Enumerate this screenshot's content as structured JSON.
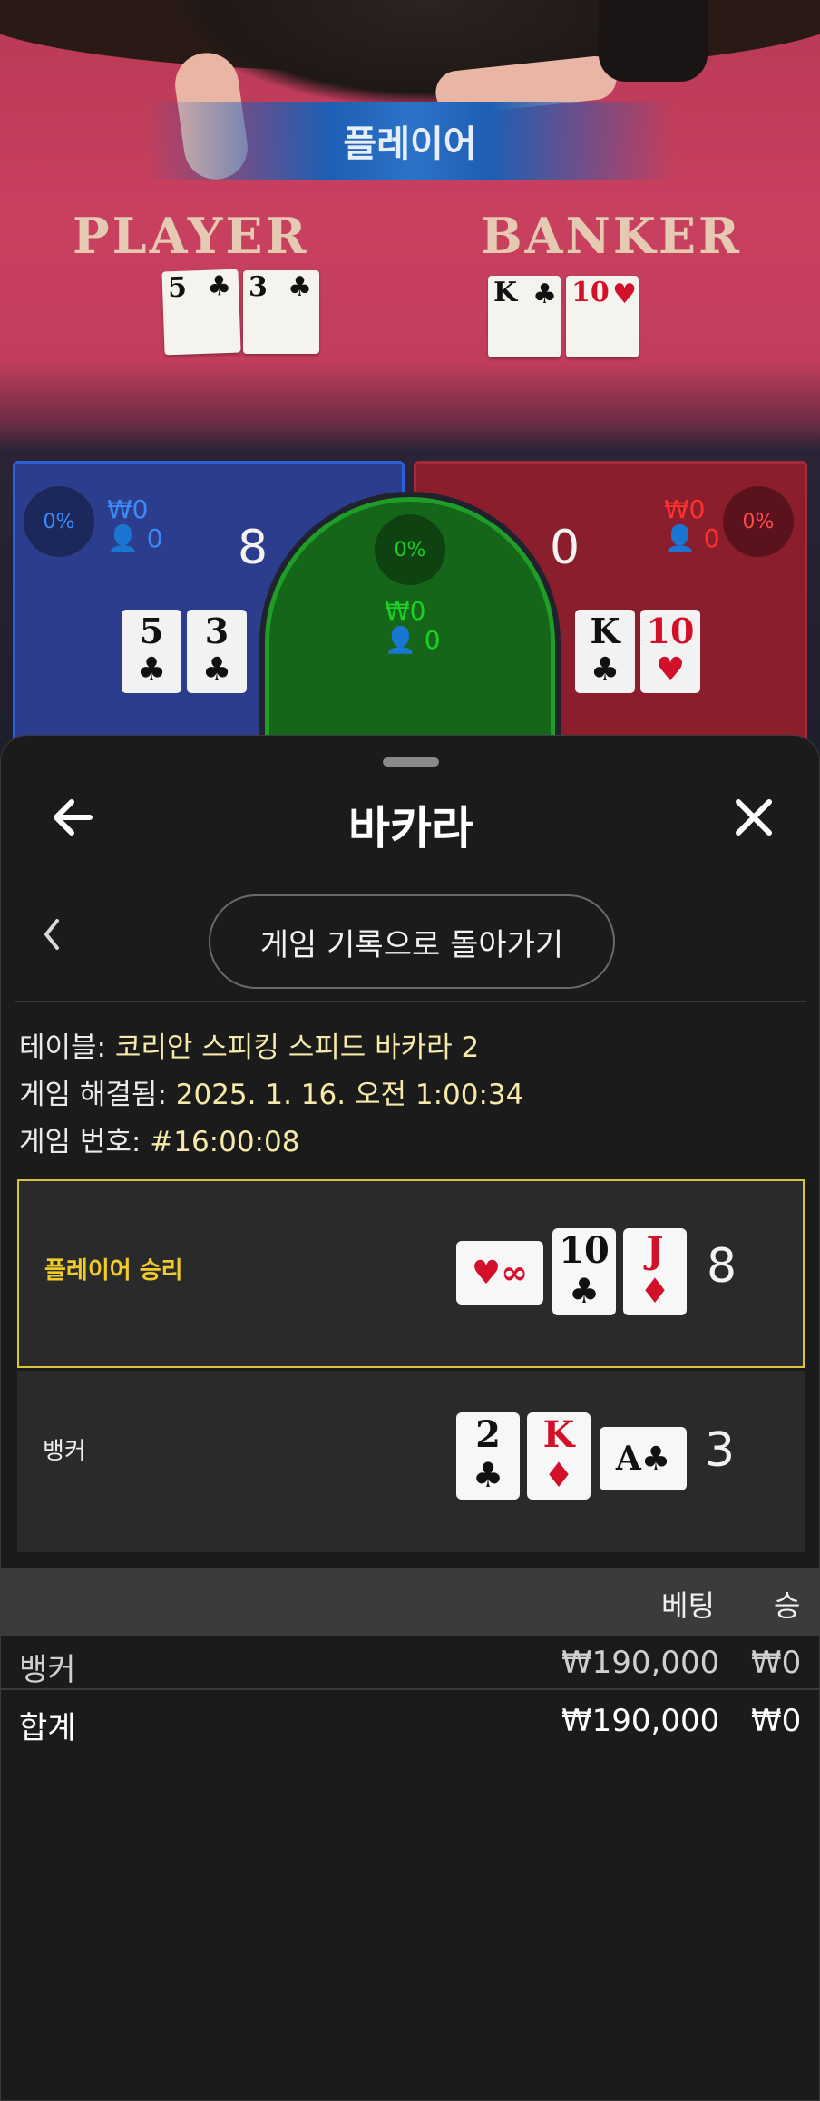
{
  "game": {
    "result_banner": "플레이어",
    "felt_player_label": "PLAYER",
    "felt_banker_label": "BANKER",
    "table_player_cards": [
      {
        "rank": "5",
        "suit": "♣",
        "color": "black"
      },
      {
        "rank": "3",
        "suit": "♣",
        "color": "black"
      }
    ],
    "table_banker_cards": [
      {
        "rank": "K",
        "suit": "♣",
        "color": "black"
      },
      {
        "rank": "10",
        "suit": "♥",
        "color": "red"
      }
    ],
    "player_zone": {
      "percent": "0%",
      "amount": "₩0",
      "count": "0",
      "score": "8",
      "cards": [
        {
          "rank": "5",
          "suit": "♣",
          "color": "black"
        },
        {
          "rank": "3",
          "suit": "♣",
          "color": "black"
        }
      ]
    },
    "tie_zone": {
      "percent": "0%",
      "amount": "₩0",
      "count": "0"
    },
    "banker_zone": {
      "percent": "0%",
      "amount": "₩0",
      "count": "0",
      "score": "0",
      "cards": [
        {
          "rank": "K",
          "suit": "♣",
          "color": "black"
        },
        {
          "rank": "10",
          "suit": "♥",
          "color": "red"
        }
      ]
    },
    "colors": {
      "player": "#2b3d8c",
      "banker": "#8b1e2c",
      "tie": "#16661a",
      "felt": "#c9405f"
    }
  },
  "sheet": {
    "title": "바카라",
    "back_icon": "arrow-left-icon",
    "close_icon": "close-icon",
    "history_button": "게임 기록으로 돌아가기",
    "table_label": "테이블:",
    "table_value": "코리안 스피킹 스피드 바카라 2",
    "resolved_label": "게임 해결됨:",
    "resolved_value": "2025. 1. 16. 오전 1:00:34",
    "game_no_label": "게임 번호:",
    "game_no_value": "#16:00:08",
    "player_hand": {
      "label": "플레이어 승리",
      "total": "8",
      "cards": [
        {
          "rank": "∞",
          "suit": "♥",
          "color": "red",
          "sideways": true
        },
        {
          "rank": "10",
          "suit": "♣",
          "color": "black"
        },
        {
          "rank": "J",
          "suit": "♦",
          "color": "red"
        }
      ]
    },
    "banker_hand": {
      "label": "뱅커",
      "total": "3",
      "cards": [
        {
          "rank": "2",
          "suit": "♣",
          "color": "black"
        },
        {
          "rank": "K",
          "suit": "♦",
          "color": "red"
        },
        {
          "rank": "A",
          "suit": "♣",
          "color": "black",
          "sideways": true
        }
      ]
    },
    "bet_table": {
      "headers": [
        "베팅",
        "승"
      ],
      "rows": [
        {
          "label": "뱅커",
          "bet": "₩190,000",
          "win": "₩0"
        },
        {
          "label": "합계",
          "bet": "₩190,000",
          "win": "₩0"
        }
      ]
    },
    "highlight_color": "#d8c33b"
  }
}
